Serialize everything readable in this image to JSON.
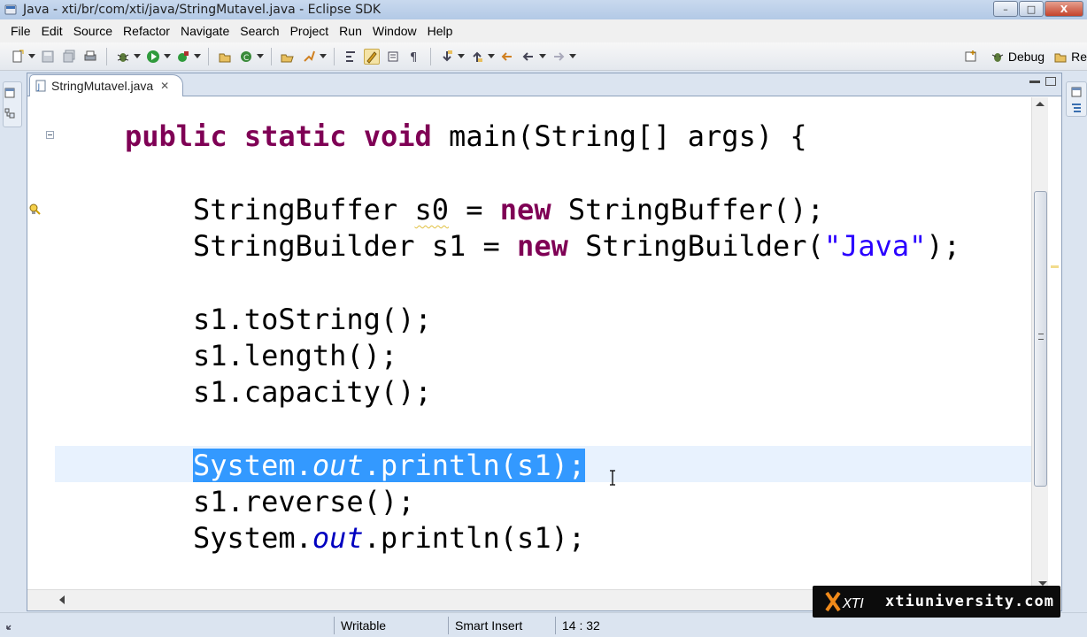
{
  "window": {
    "title": "Java - xti/br/com/xti/java/StringMutavel.java - Eclipse SDK",
    "minimize": "–",
    "maximize": "□",
    "close": "X"
  },
  "menu": [
    "File",
    "Edit",
    "Source",
    "Refactor",
    "Navigate",
    "Search",
    "Project",
    "Run",
    "Window",
    "Help"
  ],
  "perspectives": {
    "debug": "Debug",
    "resource": "Re"
  },
  "editor": {
    "tab_label": "StringMutavel.java",
    "tab_close": "✕",
    "code": {
      "l1_kw": "public static void",
      "l1_rest": " main(String[] args) {",
      "l2_pre": "StringBuffer ",
      "l2_var": "s0",
      "l2_mid": " = ",
      "l2_kw": "new",
      "l2_post": " StringBuffer();",
      "l3_pre": "StringBuilder s1 = ",
      "l3_kw": "new",
      "l3_mid": " StringBuilder(",
      "l3_str": "\"Java\"",
      "l3_post": ");",
      "l4": "s1.toString();",
      "l5": "s1.length();",
      "l6": "s1.capacity();",
      "l7_pre": "System.",
      "l7_fld": "out",
      "l7_post": ".println(s1);",
      "l8": "s1.reverse();",
      "l9_pre": "System.",
      "l9_fld": "out",
      "l9_post": ".println(s1);"
    }
  },
  "status": {
    "writable": "Writable",
    "insert_mode": "Smart Insert",
    "position": "14 : 32"
  },
  "watermark": {
    "text": "xtiuniversity.com",
    "logo_text": "XTI"
  },
  "colors": {
    "keyword": "#7f0055",
    "string": "#2a00ff",
    "field": "#0000c0",
    "selection": "#3399ff",
    "current_line": "#e8f2fe"
  }
}
